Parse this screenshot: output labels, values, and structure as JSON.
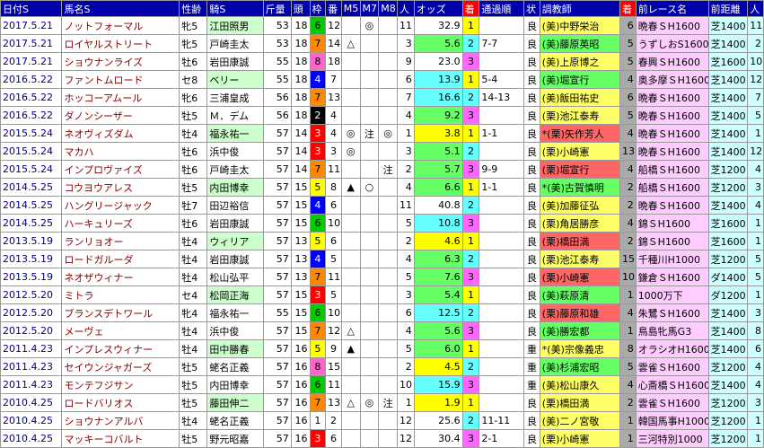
{
  "headers": [
    "日付S",
    "馬名S",
    "性齢",
    "騎S",
    "斤量",
    "頭",
    "枠",
    "番",
    "M5",
    "M7",
    "M8",
    "人",
    "オッズ",
    "着",
    "通過順",
    "状",
    "調教師",
    "着",
    "前レース名",
    "前距離",
    "人"
  ],
  "rows": [
    [
      "2017.5.21",
      "ノットフォーマル",
      "牝5",
      "江田照男",
      "53",
      "18",
      "6",
      "12",
      "",
      "◎",
      "",
      "11",
      "32.9",
      "1",
      "",
      "良",
      "(美)中野栄治",
      "6",
      "晩春ＳH1600",
      "芝1400",
      "11"
    ],
    [
      "2017.5.21",
      "ロイヤルストリート",
      "牝5",
      "戸崎圭太",
      "53",
      "18",
      "7",
      "14",
      "△",
      "",
      "",
      "3",
      "5.6",
      "2",
      "7-7",
      "良",
      "(美)藤原英昭",
      "5",
      "うずしおS1600",
      "芝1400",
      "2"
    ],
    [
      "2017.5.21",
      "ショウナンライズ",
      "牡6",
      "岩田康誠",
      "55",
      "18",
      "8",
      "18",
      "",
      "",
      "",
      "9",
      "23.0",
      "3",
      "",
      "良",
      "(美)上原博之",
      "5",
      "春興ＳH1600",
      "芝1600",
      "10"
    ],
    [
      "2016.5.22",
      "ファントムロード",
      "セ8",
      "ベリー",
      "55",
      "18",
      "4",
      "7",
      "",
      "",
      "",
      "6",
      "13.9",
      "1",
      "5-4",
      "良",
      "(美)堀宣行",
      "4",
      "奥多摩ＳH1600",
      "芝1400",
      "12"
    ],
    [
      "2016.5.22",
      "ホッコーアムール",
      "牝6",
      "三浦皇成",
      "56",
      "18",
      "7",
      "13",
      "",
      "",
      "",
      "7",
      "16.6",
      "2",
      "14-13",
      "良",
      "(美)飯田祐史",
      "6",
      "晩春ＳH1600",
      "芝1400",
      "7"
    ],
    [
      "2016.5.22",
      "ダノンシーザー",
      "牡5",
      "Ｍ．デム",
      "56",
      "18",
      "2",
      "4",
      "",
      "",
      "",
      "4",
      "9.2",
      "3",
      "",
      "良",
      "(栗)池江泰寿",
      "5",
      "晩春ＳH1600",
      "芝1400",
      "5"
    ],
    [
      "2015.5.24",
      "ネオヴィズダム",
      "牡4",
      "福永祐一",
      "57",
      "14",
      "3",
      "4",
      "◎",
      "注",
      "◎",
      "1",
      "3.8",
      "1",
      "1-1",
      "良",
      "*(栗)矢作芳人",
      "4",
      "晩春ＳH1600",
      "芝1400",
      "1"
    ],
    [
      "2015.5.24",
      "マカハ",
      "牡6",
      "浜中俊",
      "57",
      "14",
      "3",
      "3",
      "◎",
      "",
      "",
      "3",
      "5.1",
      "2",
      "",
      "良",
      "(栗)小崎憲",
      "13",
      "晩春ＳH1600",
      "芝1400",
      "12"
    ],
    [
      "2015.5.24",
      "インプロヴァイズ",
      "牡6",
      "戸崎圭太",
      "57",
      "14",
      "7",
      "11",
      "",
      "",
      "注",
      "2",
      "5.7",
      "3",
      "9-9",
      "良",
      "(栗)堀宣行",
      "4",
      "船橋ＳH1600",
      "芝1200",
      "4"
    ],
    [
      "2014.5.25",
      "コウヨウアレス",
      "牡5",
      "内田博幸",
      "57",
      "15",
      "5",
      "8",
      "▲",
      "○",
      "",
      "4",
      "6.6",
      "1",
      "1-1",
      "良",
      "*(美)古賀慎明",
      "2",
      "船橋ＳH1600",
      "芝1200",
      "3"
    ],
    [
      "2014.5.25",
      "ハングリージャック",
      "牡7",
      "田辺裕信",
      "57",
      "15",
      "4",
      "6",
      "",
      "",
      "",
      "11",
      "40.8",
      "2",
      "",
      "良",
      "(美)加藤征弘",
      "2",
      "晩春ＳH1600",
      "芝1400",
      "4"
    ],
    [
      "2014.5.25",
      "ハーキュリーズ",
      "牡6",
      "岩田康誠",
      "57",
      "15",
      "6",
      "10",
      "",
      "",
      "",
      "5",
      "10.8",
      "3",
      "",
      "良",
      "(栗)角居勝彦",
      "4",
      "錦ＳH1600",
      "芝1600",
      "1"
    ],
    [
      "2013.5.19",
      "ランリョオー",
      "牡4",
      "ウィリア",
      "57",
      "13",
      "5",
      "6",
      "",
      "",
      "",
      "2",
      "4.6",
      "1",
      "",
      "良",
      "(栗)橋田満",
      "2",
      "錦ＳH1600",
      "芝1600",
      "1"
    ],
    [
      "2013.5.19",
      "ロードガルーダ",
      "牡4",
      "岩田康誠",
      "57",
      "13",
      "4",
      "5",
      "",
      "",
      "",
      "4",
      "6.3",
      "2",
      "",
      "良",
      "(栗)池江泰寿",
      "15",
      "千種川H1000",
      "芝1200",
      "5"
    ],
    [
      "2013.5.19",
      "ネオザウィナー",
      "牡4",
      "松山弘平",
      "57",
      "13",
      "7",
      "11",
      "",
      "",
      "",
      "5",
      "7.6",
      "3",
      "",
      "良",
      "(栗)小崎憲",
      "10",
      "鎌倉ＳH1600",
      "ダ1400",
      "5"
    ],
    [
      "2012.5.20",
      "ミトラ",
      "セ4",
      "松岡正海",
      "57",
      "15",
      "3",
      "5",
      "",
      "",
      "",
      "3",
      "5.4",
      "1",
      "",
      "良",
      "(美)萩原清",
      "1",
      "1000万下",
      "ダ1200",
      "1"
    ],
    [
      "2012.5.20",
      "ブランスデトワール",
      "牝4",
      "福永祐一",
      "55",
      "15",
      "6",
      "10",
      "",
      "",
      "",
      "6",
      "12.5",
      "2",
      "",
      "良",
      "(栗)藤原和雄",
      "4",
      "朱鷺ＳH1600",
      "芝1400",
      "3"
    ],
    [
      "2012.5.20",
      "メーヴェ",
      "牡4",
      "浜中俊",
      "57",
      "15",
      "7",
      "12",
      "△",
      "",
      "",
      "4",
      "5.6",
      "3",
      "",
      "良",
      "(美)勝宏都",
      "1",
      "鳥島牝馬G3",
      "芝1400",
      "8"
    ],
    [
      "2011.4.23",
      "インプレスウィナー",
      "牡4",
      "田中勝春",
      "57",
      "16",
      "5",
      "9",
      "▲",
      "",
      "",
      "5",
      "6.0",
      "1",
      "",
      "重",
      "*(美)宗像義忠",
      "8",
      "オラシオH1600",
      "芝1400",
      "6"
    ],
    [
      "2011.4.23",
      "セイウンジャガーズ",
      "牡5",
      "蛯名正義",
      "57",
      "16",
      "8",
      "15",
      "",
      "",
      "",
      "2",
      "4.5",
      "2",
      "",
      "重",
      "(美)杉浦宏昭",
      "5",
      "雲雀ＳH1600",
      "芝1200",
      "4"
    ],
    [
      "2011.4.23",
      "モンテフジサン",
      "牡5",
      "内田博幸",
      "57",
      "16",
      "6",
      "11",
      "",
      "",
      "",
      "10",
      "15.9",
      "3",
      "",
      "重",
      "(美)松山康久",
      "4",
      "心斎橋ＳH1600",
      "芝1400",
      "4"
    ],
    [
      "2010.4.25",
      "ロードバリオス",
      "牡5",
      "藤田伸二",
      "57",
      "16",
      "7",
      "13",
      "△",
      "◎",
      "注",
      "1",
      "1.9",
      "1",
      "",
      "良",
      "(栗)橋田満",
      "2",
      "雲雀ＳH1600",
      "芝1200",
      "3"
    ],
    [
      "2010.4.25",
      "ショウナンアルバ",
      "牡4",
      "蛯名正義",
      "57",
      "16",
      "1",
      "2",
      "",
      "",
      "",
      "12",
      "25.6",
      "2",
      "11-11",
      "良",
      "(美)二ノ宮敬",
      "1",
      "韓国馬事H1000",
      "芝1200",
      "1"
    ],
    [
      "2010.4.25",
      "マッキーコバルト",
      "牡5",
      "野元昭嘉",
      "57",
      "16",
      "3",
      "6",
      "",
      "",
      "",
      "12",
      "30.4",
      "3",
      "2-1",
      "良",
      "(栗)小崎憲",
      "1",
      "三河特別1000",
      "芝1200",
      "1"
    ]
  ],
  "frame_colors": {
    "1": "#ffffff",
    "2": "#000000",
    "3": "#ff0000",
    "4": "#0000ff",
    "5": "#ffff00",
    "6": "#00cc00",
    "7": "#ff8800",
    "8": "#ff66cc"
  }
}
